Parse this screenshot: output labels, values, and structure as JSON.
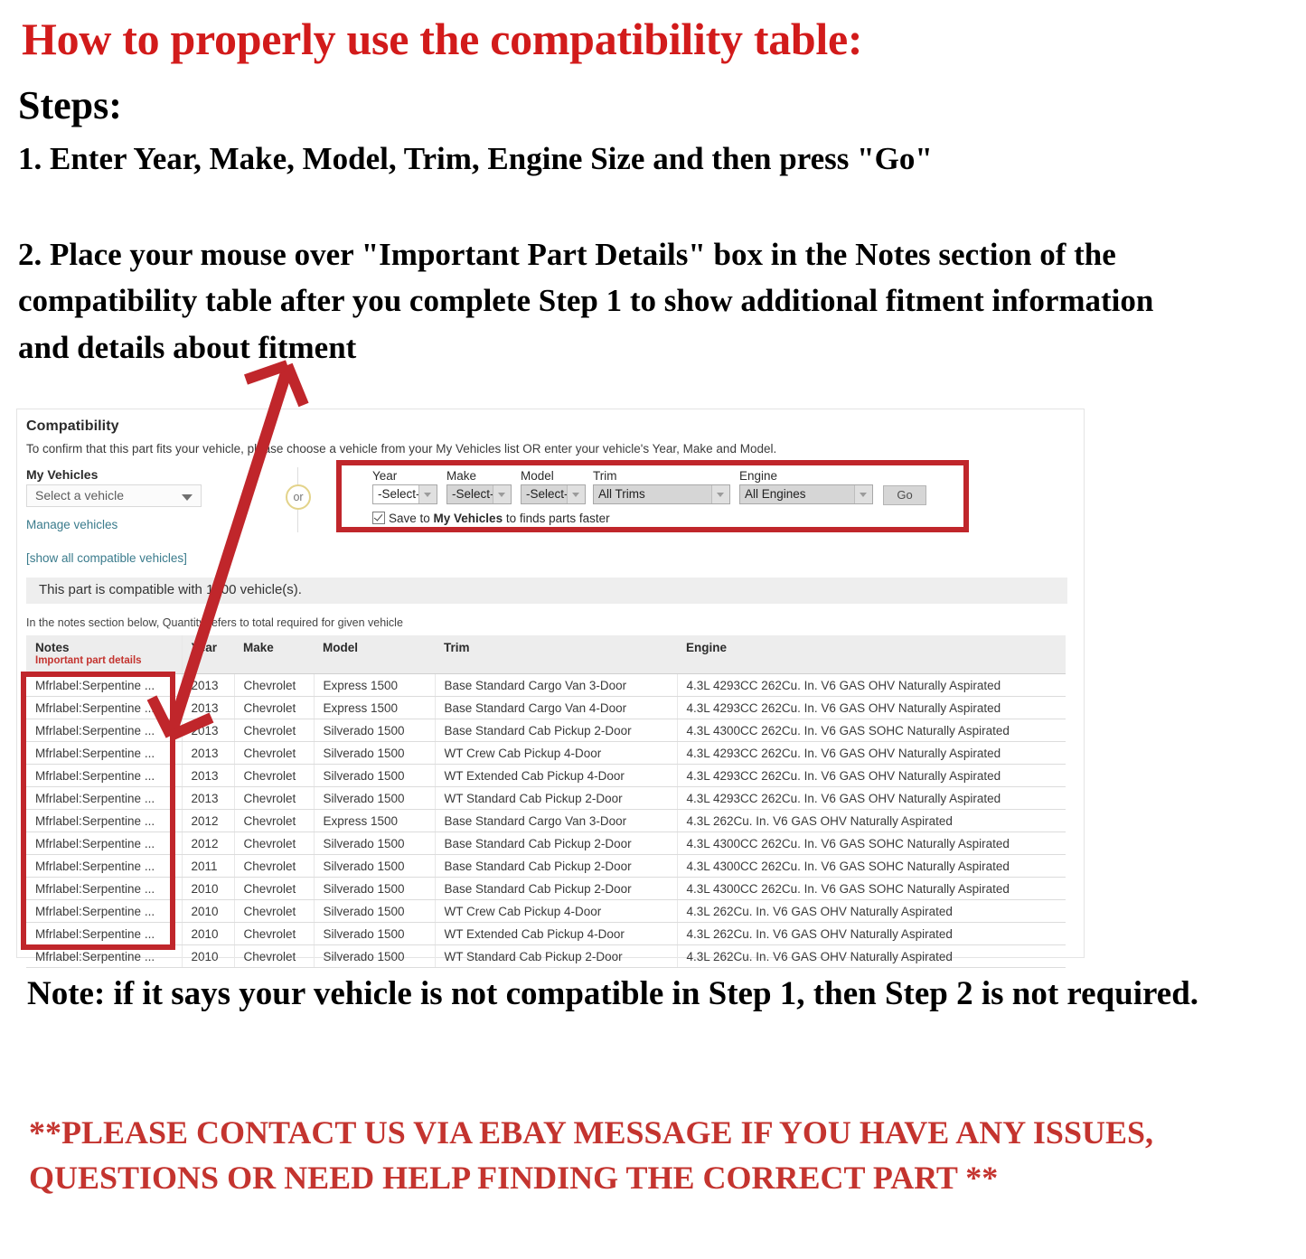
{
  "headline": "How to properly use the compatibility table:",
  "steps_label": "Steps:",
  "step_one": "1. Enter Year, Make, Model, Trim, Engine Size and then press \"Go\"",
  "step_two": "2. Place your mouse over \"Important Part Details\" box in the Notes section of the compatibility table after you complete Step 1 to show additional fitment information and details about fitment",
  "note": "Note: if it says your vehicle is not compatible in Step 1, then Step 2 is not required.",
  "contact": "**PLEASE CONTACT US VIA EBAY MESSAGE IF YOU HAVE ANY ISSUES, QUESTIONS OR NEED HELP FINDING THE CORRECT PART **",
  "colors": {
    "headline_red": "#d21b1b",
    "annotation_red": "#c0262b",
    "contact_red": "#c4342f",
    "link_teal": "#3a7b8c"
  },
  "compatibility": {
    "title": "Compatibility",
    "description": "To confirm that this part fits your vehicle, please choose a vehicle from your My Vehicles list OR enter your vehicle's Year, Make and Model.",
    "my_vehicles_label": "My Vehicles",
    "vehicle_select_value": "Select a vehicle",
    "manage_vehicles_link": "Manage vehicles",
    "show_all_link": "[show all compatible vehicles]",
    "or_divider": "or",
    "fields": [
      {
        "label": "Year",
        "value": "-Select-",
        "enabled": true
      },
      {
        "label": "Make",
        "value": "-Select-",
        "enabled": false
      },
      {
        "label": "Model",
        "value": "-Select-",
        "enabled": false
      },
      {
        "label": "Trim",
        "value": "All Trims",
        "enabled": false
      },
      {
        "label": "Engine",
        "value": "All Engines",
        "enabled": false
      }
    ],
    "go_button": "Go",
    "save_prefix": "Save to ",
    "save_bold": "My Vehicles",
    "save_suffix": " to finds parts faster",
    "count_text": "This part is compatible with 1000 vehicle(s).",
    "vehicle_count": 1000,
    "quantity_note": "In the notes section below, Quantity refers to total required for given vehicle"
  },
  "table": {
    "headers": {
      "notes": "Notes",
      "notes_sub": "Important part details",
      "year": "Year",
      "make": "Make",
      "model": "Model",
      "trim": "Trim",
      "engine": "Engine"
    },
    "rows": [
      {
        "notes": "Mfrlabel:Serpentine ...",
        "year": "2013",
        "make": "Chevrolet",
        "model": "Express 1500",
        "trim": "Base Standard Cargo Van 3-Door",
        "engine": "4.3L 4293CC 262Cu. In. V6 GAS OHV Naturally Aspirated"
      },
      {
        "notes": "Mfrlabel:Serpentine ...",
        "year": "2013",
        "make": "Chevrolet",
        "model": "Express 1500",
        "trim": "Base Standard Cargo Van 4-Door",
        "engine": "4.3L 4293CC 262Cu. In. V6 GAS OHV Naturally Aspirated"
      },
      {
        "notes": "Mfrlabel:Serpentine ...",
        "year": "2013",
        "make": "Chevrolet",
        "model": "Silverado 1500",
        "trim": "Base Standard Cab Pickup 2-Door",
        "engine": "4.3L 4300CC 262Cu. In. V6 GAS SOHC Naturally Aspirated"
      },
      {
        "notes": "Mfrlabel:Serpentine ...",
        "year": "2013",
        "make": "Chevrolet",
        "model": "Silverado 1500",
        "trim": "WT Crew Cab Pickup 4-Door",
        "engine": "4.3L 4293CC 262Cu. In. V6 GAS OHV Naturally Aspirated"
      },
      {
        "notes": "Mfrlabel:Serpentine ...",
        "year": "2013",
        "make": "Chevrolet",
        "model": "Silverado 1500",
        "trim": "WT Extended Cab Pickup 4-Door",
        "engine": "4.3L 4293CC 262Cu. In. V6 GAS OHV Naturally Aspirated"
      },
      {
        "notes": "Mfrlabel:Serpentine ...",
        "year": "2013",
        "make": "Chevrolet",
        "model": "Silverado 1500",
        "trim": "WT Standard Cab Pickup 2-Door",
        "engine": "4.3L 4293CC 262Cu. In. V6 GAS OHV Naturally Aspirated"
      },
      {
        "notes": "Mfrlabel:Serpentine ...",
        "year": "2012",
        "make": "Chevrolet",
        "model": "Express 1500",
        "trim": "Base Standard Cargo Van 3-Door",
        "engine": "4.3L 262Cu. In. V6 GAS OHV Naturally Aspirated"
      },
      {
        "notes": "Mfrlabel:Serpentine ...",
        "year": "2012",
        "make": "Chevrolet",
        "model": "Silverado 1500",
        "trim": "Base Standard Cab Pickup 2-Door",
        "engine": "4.3L 4300CC 262Cu. In. V6 GAS SOHC Naturally Aspirated"
      },
      {
        "notes": "Mfrlabel:Serpentine ...",
        "year": "2011",
        "make": "Chevrolet",
        "model": "Silverado 1500",
        "trim": "Base Standard Cab Pickup 2-Door",
        "engine": "4.3L 4300CC 262Cu. In. V6 GAS SOHC Naturally Aspirated"
      },
      {
        "notes": "Mfrlabel:Serpentine ...",
        "year": "2010",
        "make": "Chevrolet",
        "model": "Silverado 1500",
        "trim": "Base Standard Cab Pickup 2-Door",
        "engine": "4.3L 4300CC 262Cu. In. V6 GAS SOHC Naturally Aspirated"
      },
      {
        "notes": "Mfrlabel:Serpentine ...",
        "year": "2010",
        "make": "Chevrolet",
        "model": "Silverado 1500",
        "trim": "WT Crew Cab Pickup 4-Door",
        "engine": "4.3L 262Cu. In. V6 GAS OHV Naturally Aspirated"
      },
      {
        "notes": "Mfrlabel:Serpentine ...",
        "year": "2010",
        "make": "Chevrolet",
        "model": "Silverado 1500",
        "trim": "WT Extended Cab Pickup 4-Door",
        "engine": "4.3L 262Cu. In. V6 GAS OHV Naturally Aspirated"
      },
      {
        "notes": "Mfrlabel:Serpentine ...",
        "year": "2010",
        "make": "Chevrolet",
        "model": "Silverado 1500",
        "trim": "WT Standard Cab Pickup 2-Door",
        "engine": "4.3L 262Cu. In. V6 GAS OHV Naturally Aspirated"
      }
    ]
  }
}
